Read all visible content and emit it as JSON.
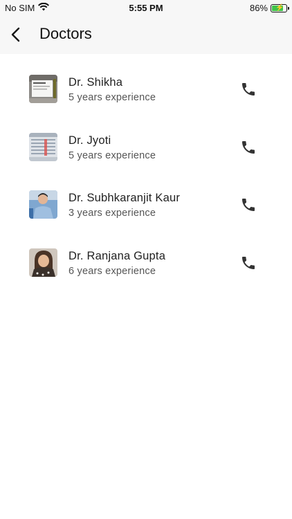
{
  "status": {
    "carrier": "No SIM",
    "time": "5:55 PM",
    "battery": "86%",
    "battery_level": 0.86,
    "battery_color": "#3fc34a"
  },
  "header": {
    "back_icon": "chevron-left-icon",
    "title": "Doctors"
  },
  "doctors": [
    {
      "name": "Dr. Shikha",
      "experience": "5 years experience",
      "call_icon": "phone-icon"
    },
    {
      "name": "Dr. Jyoti",
      "experience": "5 years experience",
      "call_icon": "phone-icon"
    },
    {
      "name": "Dr. Subhkaranjit Kaur",
      "experience": "3 years experience",
      "call_icon": "phone-icon"
    },
    {
      "name": "Dr. Ranjana Gupta",
      "experience": "6 years experience",
      "call_icon": "phone-icon"
    }
  ]
}
